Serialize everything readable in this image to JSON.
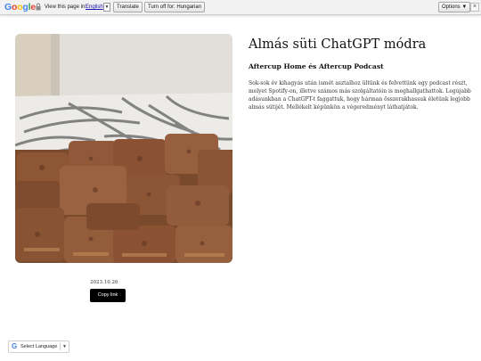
{
  "translate_bar": {
    "logo": "Google",
    "view_text": "View this page in:",
    "language": "English",
    "dropdown_arrow": "▼",
    "translate_label": "Translate",
    "turn_off_label": "Turn off for: Hungarian",
    "options_label": "Options ▼",
    "close_label": "×"
  },
  "article": {
    "title": "Almás süti ChatGPT módra",
    "subtitle": "Aftercup Home és Aftercup Podcast",
    "body": "Sok-sok év kihagyás után ismét asztalhoz ültünk és felvettünk egy podcast részt, melyet Spotify-on, illetve számos más szolgáltatóin is meghallgathattok. Legújabb adásunkban a ChatGPT-t faggattuk, hogy hárman összerakhassuk életünk legjobb almás sütijét. Mellékelt képünkön a végeredményt láthatjátok.",
    "date": "2023.10.26",
    "copy_link_label": "Copy link",
    "photo_icon": "apple-cake-photo"
  },
  "language_widget": {
    "label": "Select Language",
    "arrow": "▼"
  },
  "colors": {
    "link_blue": "#1a0dab",
    "button_black": "#000000"
  }
}
